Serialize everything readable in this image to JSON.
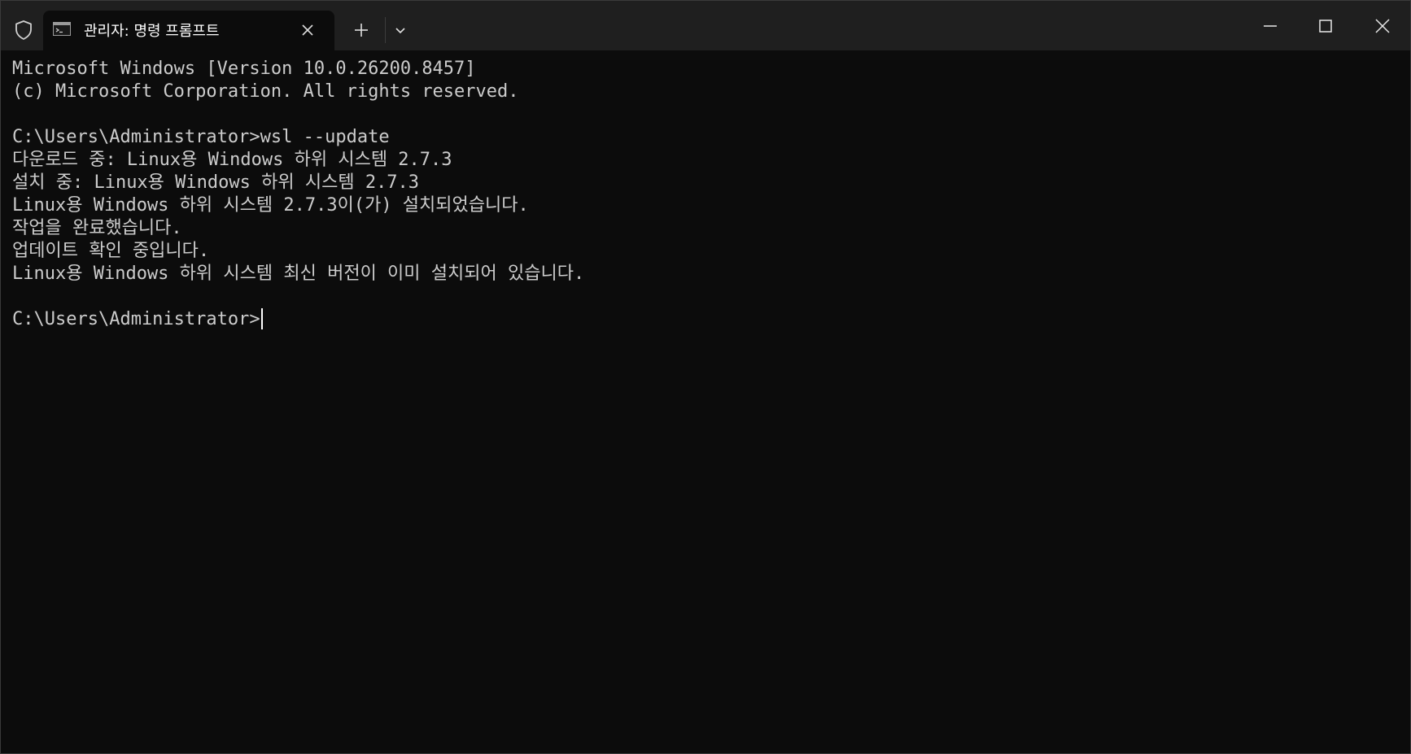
{
  "titlebar": {
    "tab_title": "관리자: 명령 프롬프트"
  },
  "icons": {
    "shield": "shield-icon",
    "terminal": "terminal-icon",
    "close_tab": "close-icon",
    "new_tab": "plus-icon",
    "dropdown": "chevron-down-icon",
    "minimize": "minimize-icon",
    "maximize": "maximize-icon",
    "close_window": "close-icon"
  },
  "console": {
    "lines": [
      "Microsoft Windows [Version 10.0.26200.8457]",
      "(c) Microsoft Corporation. All rights reserved.",
      "",
      "C:\\Users\\Administrator>wsl --update",
      "다운로드 중: Linux용 Windows 하위 시스템 2.7.3",
      "설치 중: Linux용 Windows 하위 시스템 2.7.3",
      "Linux용 Windows 하위 시스템 2.7.3이(가) 설치되었습니다.",
      "작업을 완료했습니다.",
      "업데이트 확인 중입니다.",
      "Linux용 Windows 하위 시스템 최신 버전이 이미 설치되어 있습니다.",
      ""
    ],
    "prompt": "C:\\Users\\Administrator>"
  },
  "colors": {
    "console_bg": "#0c0c0c",
    "titlebar_bg": "#1f1f1f",
    "text": "#cccccc"
  }
}
